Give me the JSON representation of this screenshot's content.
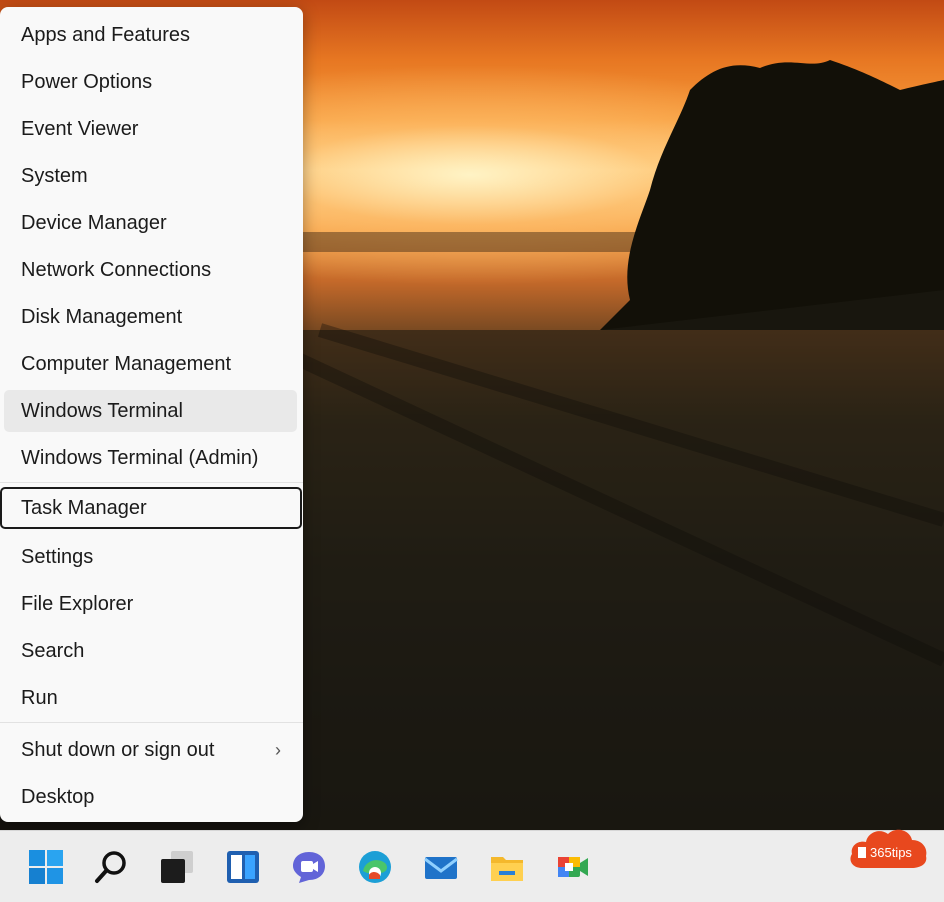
{
  "menu": {
    "items": [
      {
        "label": "Apps and Features"
      },
      {
        "label": "Power Options"
      },
      {
        "label": "Event Viewer"
      },
      {
        "label": "System"
      },
      {
        "label": "Device Manager"
      },
      {
        "label": "Network Connections"
      },
      {
        "label": "Disk Management"
      },
      {
        "label": "Computer Management"
      },
      {
        "label": "Windows Terminal"
      },
      {
        "label": "Windows Terminal (Admin)"
      },
      {
        "label": "Task Manager"
      },
      {
        "label": "Settings"
      },
      {
        "label": "File Explorer"
      },
      {
        "label": "Search"
      },
      {
        "label": "Run"
      },
      {
        "label": "Shut down or sign out",
        "submenu_icon": "chevron-right-icon"
      },
      {
        "label": "Desktop"
      }
    ]
  },
  "taskbar": {
    "icons": [
      "windows-start-icon",
      "search-icon",
      "task-view-icon",
      "widgets-icon",
      "teams-chat-icon",
      "edge-icon",
      "mail-icon",
      "file-explorer-icon",
      "meet-icon"
    ]
  },
  "brand": {
    "text": "365tips"
  },
  "colors": {
    "menu_bg": "#f9f9f9",
    "taskbar_bg": "#ededed",
    "brand_red": "#e8481e"
  }
}
